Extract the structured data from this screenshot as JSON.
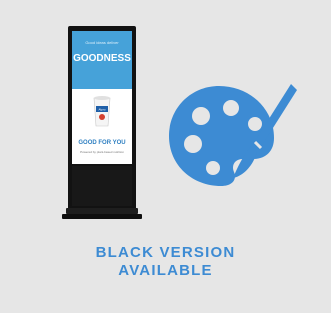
{
  "screen": {
    "headline_small": "Good ideas deliver",
    "headline_big": "GOODNESS",
    "product_label": "Alpro",
    "tagline": "GOOD FOR YOU",
    "subline": "Powered by plant-based nutrition"
  },
  "caption": {
    "line1": "BLACK VERSION",
    "line2": "AVAILABLE"
  },
  "colors": {
    "background": "#e6e6e6",
    "accent": "#3d8bd3",
    "kiosk_body": "#121212"
  },
  "icons": {
    "palette": "paint-palette-icon"
  }
}
